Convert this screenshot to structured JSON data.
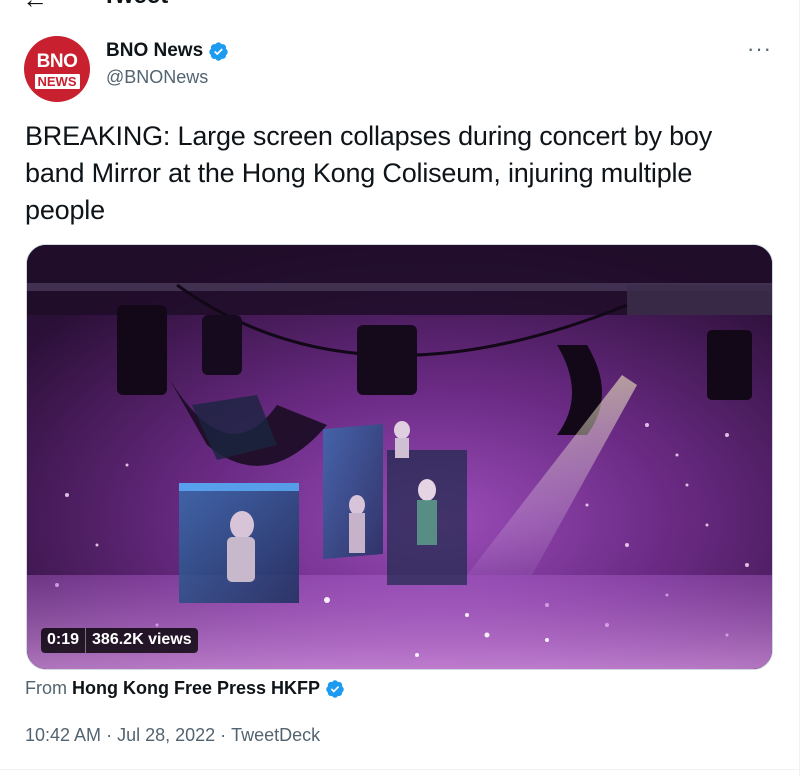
{
  "header": {
    "title": "Tweet",
    "back_icon": "back-arrow-icon"
  },
  "author": {
    "avatar_line1": "BNO",
    "avatar_line2": "NEWS",
    "display_name": "BNO News",
    "handle": "@BNONews",
    "verified": true,
    "more_icon": "more-horizontal-icon",
    "more_glyph": "···"
  },
  "tweet": {
    "text": "BREAKING: Large screen collapses during concert by boy band Mirror at the Hong Kong Coliseum, injuring multiple people"
  },
  "media": {
    "type": "video",
    "duration": "0:19",
    "views": "386.2K views"
  },
  "source": {
    "prefix": "From",
    "name": "Hong Kong Free Press HKFP",
    "verified": true
  },
  "meta": {
    "time": "10:42 AM",
    "separator": "·",
    "date": "Jul 28, 2022",
    "client": "TweetDeck"
  },
  "colors": {
    "accent": "#1d9bf0",
    "text_primary": "#0f1419",
    "text_secondary": "#536471",
    "avatar_bg": "#c8202e"
  }
}
